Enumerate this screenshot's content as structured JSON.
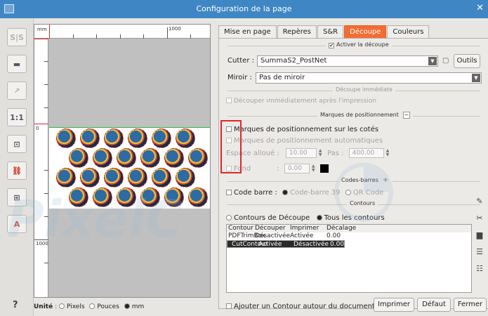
{
  "window": {
    "title": "Configuration de la page",
    "close_glyph": "✕"
  },
  "left_toolbar": [
    {
      "name": "sep-tool-button",
      "label": "S|S",
      "enabled": false
    },
    {
      "name": "align-tool-button",
      "label": "▬",
      "enabled": true
    },
    {
      "name": "export-tool-button",
      "label": "↗",
      "enabled": false
    },
    {
      "name": "scale-tool-button",
      "label": "1:1",
      "enabled": true
    },
    {
      "name": "fit-tool-button",
      "label": "⊡",
      "enabled": true
    },
    {
      "name": "link-tool-button",
      "label": "⛓",
      "enabled": true
    },
    {
      "name": "grid-tool-button",
      "label": "⊞",
      "enabled": true
    },
    {
      "name": "text-tool-button",
      "label": "A",
      "enabled": true
    }
  ],
  "preview": {
    "ruler_unit": "mm",
    "h_ruler_label": "1000",
    "v_ruler_top": "0",
    "v_ruler_label": "1000"
  },
  "tabs": [
    "Mise en page",
    "Repères",
    "S&R",
    "Découpe",
    "Couleurs"
  ],
  "active_tab": "Découpe",
  "cut": {
    "activate_label": "Activer la découpe",
    "activate_checked": true,
    "cutter_label": "Cutter",
    "cutter_value": "SummaS2_PostNet",
    "tools_button": "Outils",
    "mirror_label": "Miroir",
    "mirror_value": "Pas de miroir"
  },
  "immediate": {
    "section": "Découpe immédiate",
    "option": "Découper immédiatement après l'impression"
  },
  "marks": {
    "section": "Marques de positionnement",
    "collapse": "−",
    "sides": "Marques de positionnement sur les cotés",
    "auto": "Marques de positionnement automatiques",
    "space_label": "Espace alloué",
    "space_value": "10.00",
    "step_label": "Pas",
    "step_value": "400.00",
    "fill_label": "Fond",
    "fill_value": "0.00"
  },
  "barcodes": {
    "section": "Codes-barres",
    "expand": "+",
    "barcode_label": "Code barre",
    "opt1": "Code-barre 39",
    "opt2": "QR Code"
  },
  "contours": {
    "section": "Contours",
    "radio1": "Contours de Découpe",
    "radio2": "Tous les contours",
    "headers": [
      "Contour",
      "Découper",
      "Imprimer",
      "Décalage"
    ],
    "rows": [
      [
        "PDFTrimBox",
        "Désactivée",
        "Activée",
        "0.00"
      ],
      [
        "CutContour",
        "Activée",
        "Désactivée",
        "0.00"
      ]
    ],
    "add_doc_contour": "Ajouter un Contour autour du document"
  },
  "bottom": {
    "unit_label": "Unité",
    "units": [
      "Pixels",
      "Pouces",
      "mm"
    ],
    "selected_unit": "mm",
    "print_button": "Imprimer",
    "default_button": "Défaut",
    "close_button": "Fermer"
  },
  "side_icons": [
    "pencil-icon",
    "scissors-icon",
    "printer-icon",
    "list-icon",
    "list-add-icon"
  ],
  "colors": {
    "titlebar": "#3f87c4",
    "active_tab": "#f36d33",
    "highlight_box": "#e0262b"
  }
}
